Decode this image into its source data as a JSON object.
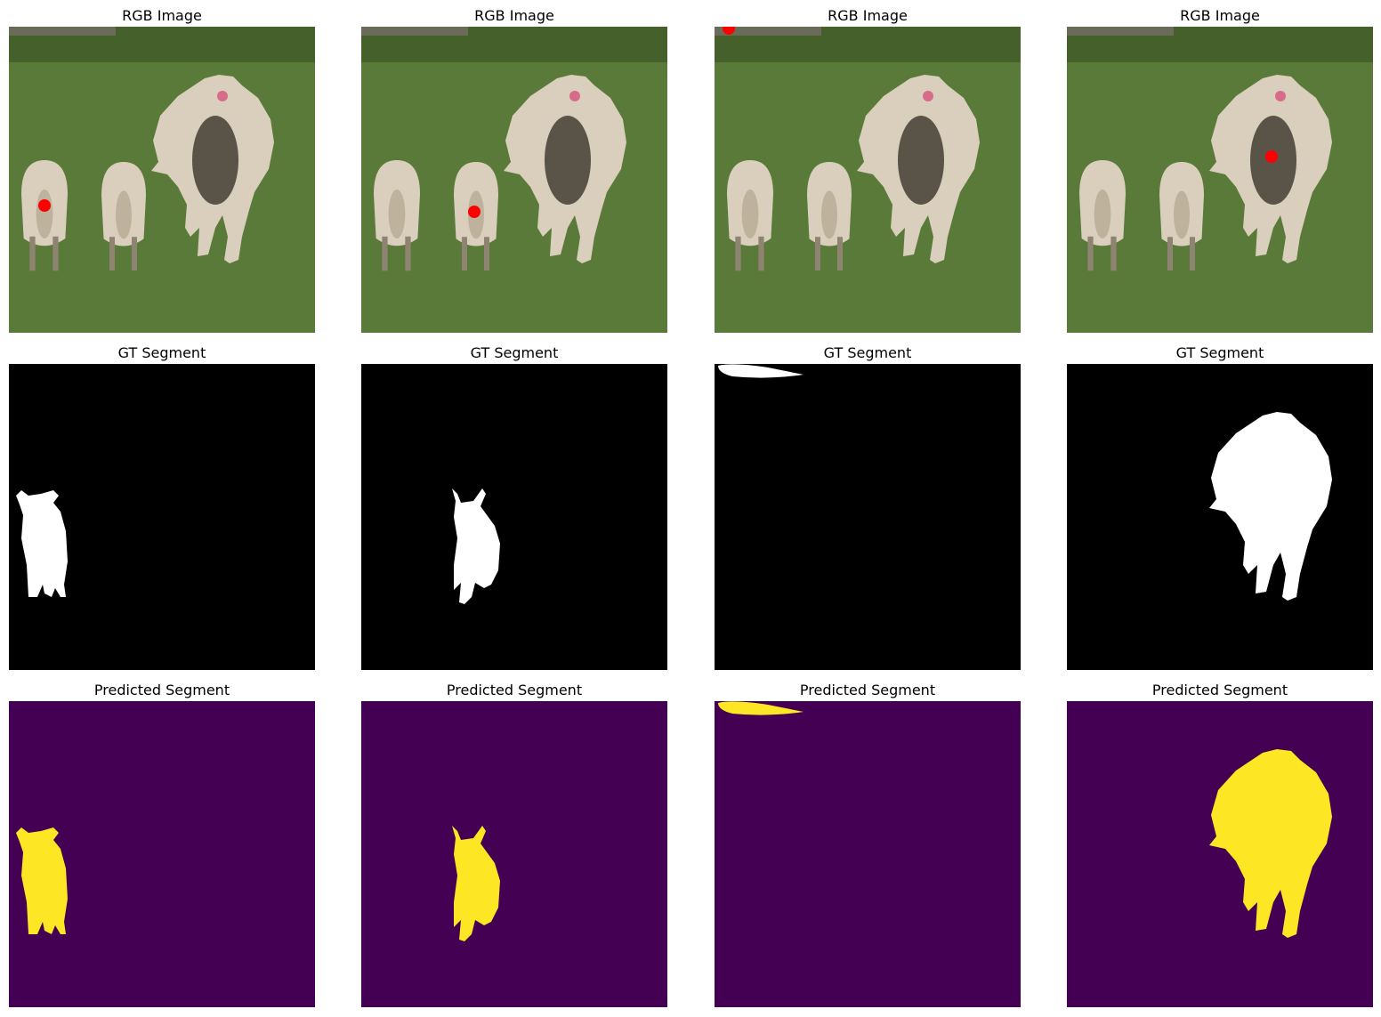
{
  "rows": [
    {
      "title": "RGB Image"
    },
    {
      "title": "GT Segment"
    },
    {
      "title": "Predicted Segment"
    }
  ],
  "colors": {
    "grass": "#5a7a3a",
    "grass_dark": "#46602c",
    "wool": "#d9cfbc",
    "wool_shadow": "#8f8472",
    "point": "#ff0000",
    "gt_background": "#000000",
    "gt_mask": "#ffffff",
    "pred_background": "#440154",
    "pred_mask": "#fde725"
  },
  "columns": [
    {
      "query_target": "left-lamb"
    },
    {
      "query_target": "middle-lamb"
    },
    {
      "query_target": "top-left-corner-strip"
    },
    {
      "query_target": "adult-sheep"
    }
  ]
}
